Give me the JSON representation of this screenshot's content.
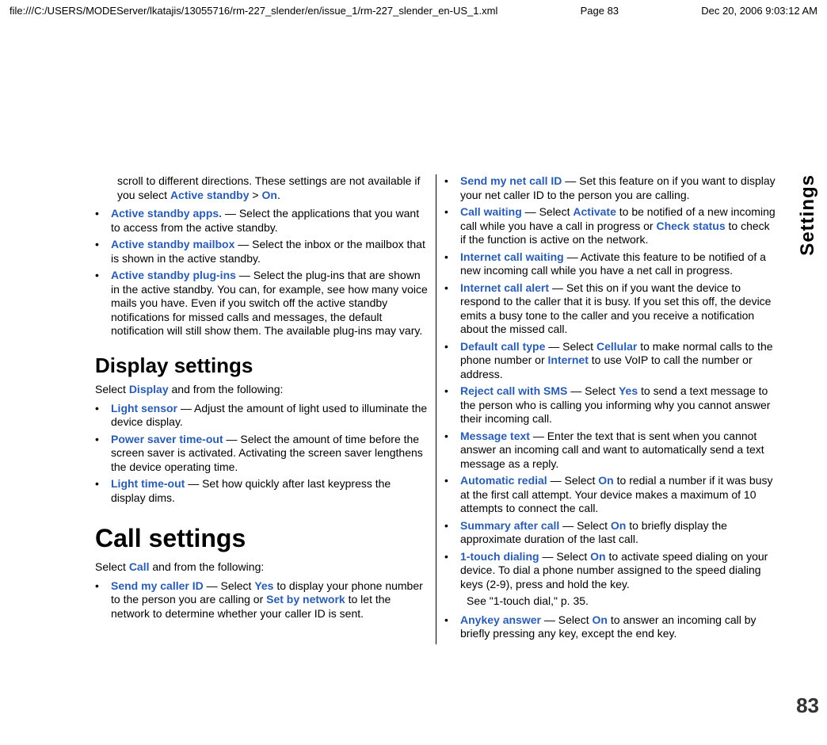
{
  "header": {
    "file_path": "file:///C:/USERS/MODEServer/lkatajis/13055716/rm-227_slender/en/issue_1/rm-227_slender_en-US_1.xml",
    "page_label": "Page 83",
    "timestamp": "Dec 20, 2006 9:03:12 AM"
  },
  "side_tab": "Settings",
  "page_number": "83",
  "left_col": {
    "intro": {
      "t0": "scroll to different directions. These settings are not available if you select ",
      "kw0": "Active standby",
      "t1": " > ",
      "kw1": "On",
      "t2": "."
    },
    "items1": [
      {
        "kw": "Active standby apps.",
        "text": " — Select the applications that you want to access from the active standby."
      },
      {
        "kw": "Active standby mailbox",
        "text": " — Select the inbox or the mailbox that is shown in the active standby."
      },
      {
        "kw": "Active standby plug-ins",
        "text": " — Select the plug-ins that are shown in the active standby. You can, for example, see how many voice mails you have. Even if you switch off the active standby notifications for missed calls and messages, the default notification will still show them. The available plug-ins may vary."
      }
    ],
    "display_heading": "Display settings",
    "display_intro_pre": "Select ",
    "display_intro_kw": "Display",
    "display_intro_post": " and from the following:",
    "items2": [
      {
        "kw": "Light sensor",
        "text": " — Adjust the amount of light used to illuminate the device display."
      },
      {
        "kw": "Power saver time-out",
        "text": " — Select the amount of time before the screen saver is activated. Activating the screen saver lengthens the device operating time."
      },
      {
        "kw": "Light time-out",
        "text": " — Set how quickly after last keypress the display dims."
      }
    ],
    "call_heading": "Call settings",
    "call_intro_pre": "Select ",
    "call_intro_kw": "Call",
    "call_intro_post": " and from the following:",
    "call_item": {
      "kw": "Send my caller ID",
      "t0": " — Select ",
      "kw1": "Yes",
      "t1": " to display your phone number to the person you are calling or ",
      "kw2": "Set by network",
      "t2": " to let the network to determine whether your caller ID is sent."
    }
  },
  "right_col": {
    "items": [
      {
        "kw": "Send my net call ID",
        "text": " — Set this feature on if you want to display your net caller ID to the person you are calling."
      },
      {
        "kw": "Call waiting",
        "t0": " — Select ",
        "kw1": "Activate",
        "t1": " to be notified of a new incoming call while you have a call in progress or ",
        "kw2": "Check status",
        "t2": " to check if the function is active on the network."
      },
      {
        "kw": "Internet call waiting",
        "text": " — Activate this feature to be notified of a new incoming call while you have a net call in progress."
      },
      {
        "kw": "Internet call alert",
        "text": " — Set this on if you want the device to respond to the caller that it is busy. If you set this off, the device emits a busy tone to the caller and you receive a notification about the missed call."
      },
      {
        "kw": "Default call type",
        "t0": " — Select ",
        "kw1": "Cellular",
        "t1": " to make normal calls to the phone number or ",
        "kw2": "Internet",
        "t2": " to use VoIP to call the number or address."
      },
      {
        "kw": "Reject call with SMS",
        "t0": " — Select ",
        "kw1": "Yes",
        "t1": " to send a text message to the person who is calling you informing why you cannot answer their incoming call."
      },
      {
        "kw": "Message text",
        "text": " — Enter the text that is sent when you cannot answer an incoming call and want to automatically send a text message as a reply."
      },
      {
        "kw": "Automatic redial",
        "t0": " — Select ",
        "kw1": "On",
        "t1": " to redial a number if it was busy at the first call attempt. Your device makes a maximum of 10 attempts to connect the call."
      },
      {
        "kw": "Summary after call",
        "t0": " — Select ",
        "kw1": "On",
        "t1": " to briefly display the approximate duration of the last call."
      },
      {
        "kw": "1-touch dialing",
        "t0": " — Select ",
        "kw1": "On",
        "t1": " to activate speed dialing on your device. To dial a phone number assigned to the speed dialing keys (2-9), press and hold the key."
      }
    ],
    "extra_para": "See \"1-touch dial,\" p. 35.",
    "last_item": {
      "kw": "Anykey answer",
      "t0": " — Select ",
      "kw1": "On",
      "t1": " to answer an incoming call by briefly pressing any key, except the end key."
    }
  }
}
